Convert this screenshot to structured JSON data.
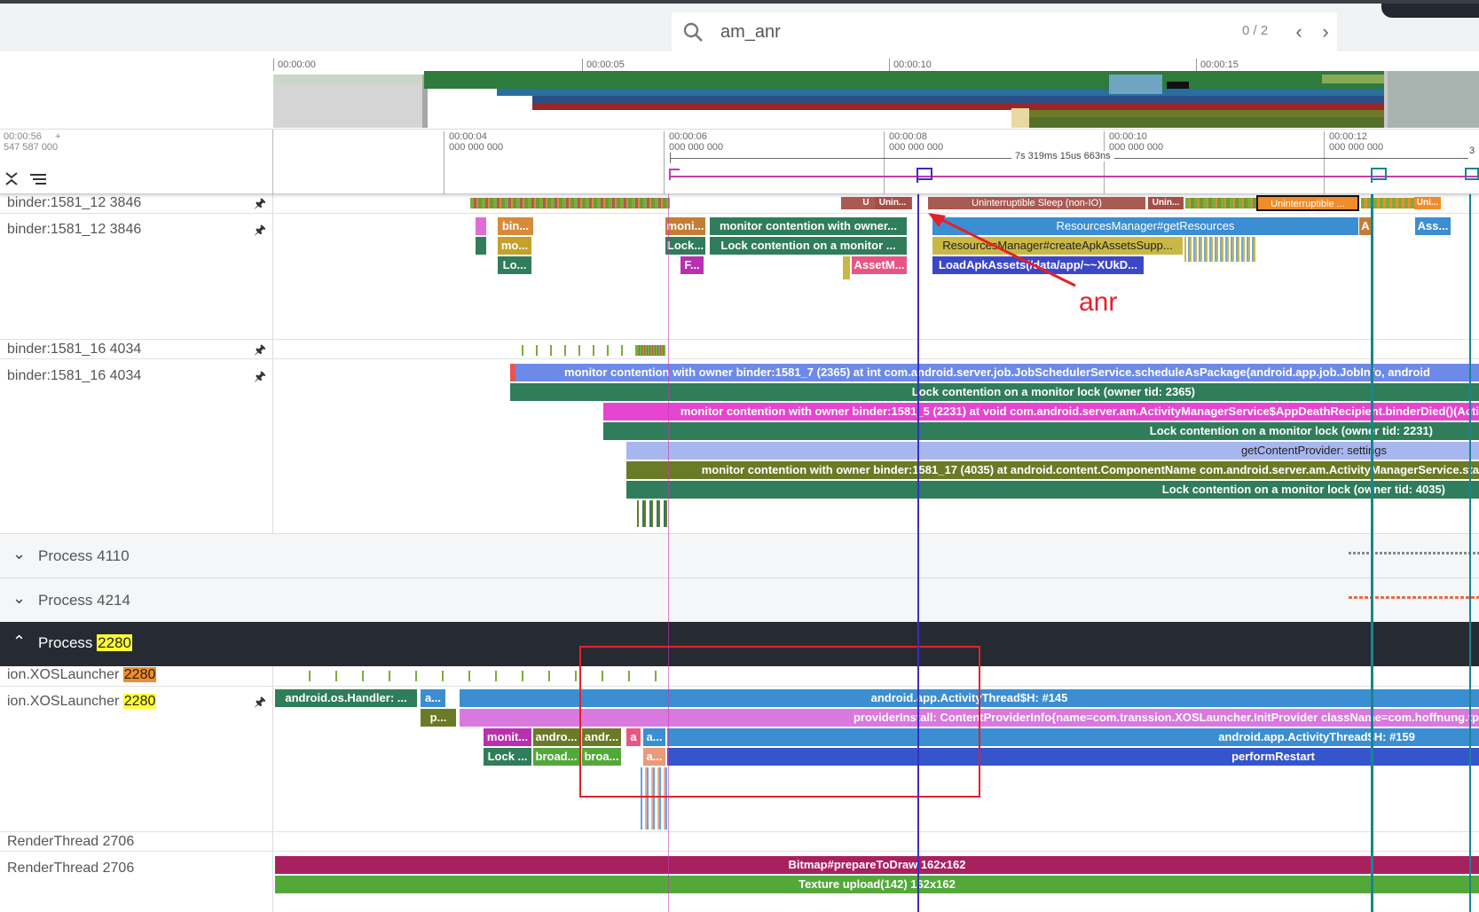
{
  "search": {
    "query": "am_anr",
    "count": "0 / 2"
  },
  "overview": {
    "ticks": [
      "00:00:00",
      "00:00:05",
      "00:00:10",
      "00:00:15"
    ]
  },
  "ruler": {
    "current_time_line1": "00:00:56",
    "current_time_line2": "547 587 000",
    "plus": "+",
    "ticks": [
      {
        "l1": "00:00:04",
        "l2": "000 000 000"
      },
      {
        "l1": "00:00:06",
        "l2": "000 000 000"
      },
      {
        "l1": "00:00:08",
        "l2": "000 000 000"
      },
      {
        "l1": "00:00:10",
        "l2": "000 000 000"
      },
      {
        "l1": "00:00:12",
        "l2": "000 000 000"
      }
    ],
    "span_label": "7s 319ms 15us 663ns",
    "edge_label": "3"
  },
  "tracks": {
    "t1_summary": "binder:1581_12 3846",
    "t1": "binder:1581_12 3846",
    "t2_summary": "binder:1581_16 4034",
    "t2": "binder:1581_16 4034",
    "p4110_label": "Process 4110",
    "p4214_label": "Process 4214",
    "p2280_label": "Process",
    "p2280_pid": "2280",
    "xos_summary_name": "ion.XOSLauncher",
    "xos_summary_pid": "2280",
    "xos_name": "ion.XOSLauncher",
    "xos_pid": "2280",
    "rt_summary": "RenderThread 2706",
    "rt": "RenderThread 2706"
  },
  "slices": {
    "state_u": "U",
    "state_unin1": "Unin...",
    "state_sleep": "Uninterruptible Sleep (non-IO)",
    "state_unin2": "Unin...",
    "state_selected": "Uninterruptible ...",
    "state_uni": "Uni...",
    "t1_bin": "bin...",
    "t1_mo": "mo...",
    "t1_lo": "Lo...",
    "t1_moni": "moni...",
    "t1_lock": "Lock...",
    "t1_f": "F...",
    "t1_monitor": "monitor contention with owner...",
    "t1_lockcont": "Lock contention on a monitor ...",
    "t1_assetm": "AssetM...",
    "t1_resources": "ResourcesManager#getResources",
    "t1_a": "A",
    "t1_ass": "Ass...",
    "t1_create": "ResourcesManager#createApkAssetsSupp...",
    "t1_load": "LoadApkAssets(/data/app/~~XUkD...",
    "t2_1": "monitor contention with owner binder:1581_7 (2365) at int com.android.server.job.JobSchedulerService.scheduleAsPackage(android.app.job.JobInfo, android",
    "t2_2": "Lock contention on a monitor lock (owner tid: 2365)",
    "t2_3": "monitor contention with owner binder:1581_5 (2231) at void com.android.server.am.ActivityManagerService$AppDeathRecipient.binderDied()(Acti",
    "t2_4": "Lock contention on a monitor lock (owner tid: 2231)",
    "t2_5": "getContentProvider: settings",
    "t2_6": "monitor contention with owner binder:1581_17 (4035) at android.content.ComponentName com.android.server.am.ActivityManagerService.sta",
    "t2_7": "Lock contention on a monitor lock (owner tid: 4035)",
    "x_handler": "android.os.Handler: ...",
    "x_a": "a...",
    "x_p": "p...",
    "x_activity145": "android.app.ActivityThread$H: #145",
    "x_provider": "providerInstall: ContentProviderInfo{name=com.transsion.XOSLauncher.InitProvider className=com.hoffnung.tp",
    "x_monit": "monit...",
    "x_andro": "andro...",
    "x_andr": "andr...",
    "x_a2": "a",
    "x_a3": "a...",
    "x_activity159": "android.app.ActivityThread$H: #159",
    "x_lock": "Lock ...",
    "x_broad": "broad...",
    "x_broa": "broa...",
    "x_a4": "a...",
    "x_restart": "performRestart",
    "rt_bitmap": "Bitmap#prepareToDraw 162x162",
    "rt_texture": "Texture upload(142) 162x162"
  },
  "annotation": {
    "label": "anr",
    "color": "#e5202a"
  },
  "colors": {
    "flag_blue": "#3b2ec0",
    "flag_teal": "#17868f",
    "select": "#f28c28"
  }
}
